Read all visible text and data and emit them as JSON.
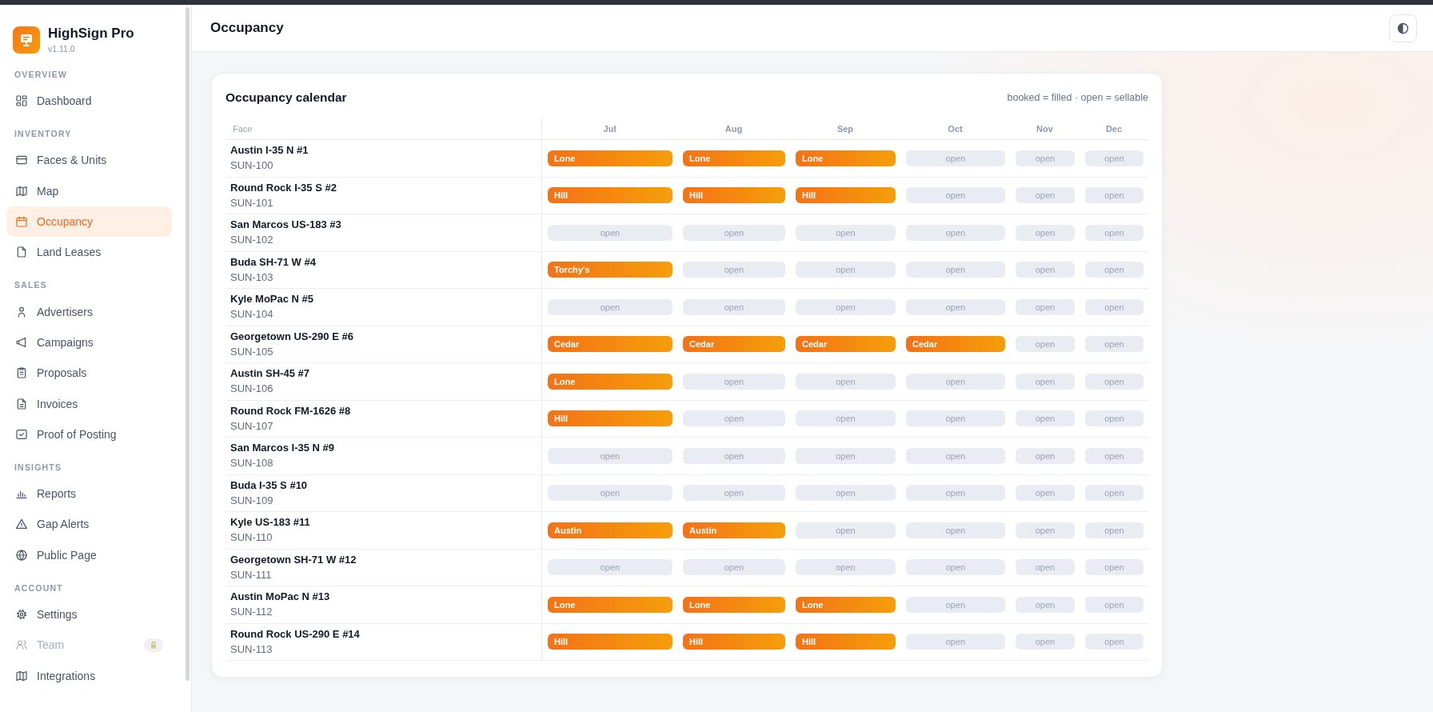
{
  "app": {
    "name": "HighSign Pro",
    "version": "v1.11.0"
  },
  "sidebar": {
    "sections": [
      {
        "title": "OVERVIEW",
        "items": [
          {
            "label": "Dashboard",
            "selected": false,
            "disabled": false
          }
        ]
      },
      {
        "title": "INVENTORY",
        "items": [
          {
            "label": "Faces & Units",
            "selected": false,
            "disabled": false
          },
          {
            "label": "Map",
            "selected": false,
            "disabled": false
          },
          {
            "label": "Occupancy",
            "selected": true,
            "disabled": false
          },
          {
            "label": "Land Leases",
            "selected": false,
            "disabled": false
          }
        ]
      },
      {
        "title": "SALES",
        "items": [
          {
            "label": "Advertisers",
            "selected": false,
            "disabled": false
          },
          {
            "label": "Campaigns",
            "selected": false,
            "disabled": false
          },
          {
            "label": "Proposals",
            "selected": false,
            "disabled": false
          },
          {
            "label": "Invoices",
            "selected": false,
            "disabled": false
          },
          {
            "label": "Proof of Posting",
            "selected": false,
            "disabled": false
          }
        ]
      },
      {
        "title": "INSIGHTS",
        "items": [
          {
            "label": "Reports",
            "selected": false,
            "disabled": false
          },
          {
            "label": "Gap Alerts",
            "selected": false,
            "disabled": false
          },
          {
            "label": "Public Page",
            "selected": false,
            "disabled": false
          }
        ]
      },
      {
        "title": "ACCOUNT",
        "items": [
          {
            "label": "Settings",
            "selected": false,
            "disabled": false
          },
          {
            "label": "Team",
            "selected": false,
            "disabled": true
          },
          {
            "label": "Integrations",
            "selected": false,
            "disabled": false
          }
        ]
      }
    ]
  },
  "header": {
    "title": "Occupancy"
  },
  "calendar": {
    "title": "Occupancy calendar",
    "legend": "booked = filled · open = sellable",
    "columns": [
      "Face",
      "Jul",
      "Aug",
      "Sep",
      "Oct",
      "Nov",
      "Dec"
    ],
    "rows": [
      {
        "name": "Austin I-35 N #1",
        "code": "SUN-100",
        "slots": [
          {
            "kind": "booked",
            "text": "Lone"
          },
          {
            "kind": "booked",
            "text": "Lone"
          },
          {
            "kind": "booked",
            "text": "Lone"
          },
          {
            "kind": "open",
            "text": "open"
          },
          {
            "kind": "open",
            "text": "open"
          },
          {
            "kind": "open",
            "text": "open"
          }
        ]
      },
      {
        "name": "Round Rock I-35 S #2",
        "code": "SUN-101",
        "slots": [
          {
            "kind": "booked",
            "text": "Hill"
          },
          {
            "kind": "booked",
            "text": "Hill"
          },
          {
            "kind": "booked",
            "text": "Hill"
          },
          {
            "kind": "open",
            "text": "open"
          },
          {
            "kind": "open",
            "text": "open"
          },
          {
            "kind": "open",
            "text": "open"
          }
        ]
      },
      {
        "name": "San Marcos US-183 #3",
        "code": "SUN-102",
        "slots": [
          {
            "kind": "open",
            "text": "open"
          },
          {
            "kind": "open",
            "text": "open"
          },
          {
            "kind": "open",
            "text": "open"
          },
          {
            "kind": "open",
            "text": "open"
          },
          {
            "kind": "open",
            "text": "open"
          },
          {
            "kind": "open",
            "text": "open"
          }
        ]
      },
      {
        "name": "Buda SH-71 W #4",
        "code": "SUN-103",
        "slots": [
          {
            "kind": "booked",
            "text": "Torchy's"
          },
          {
            "kind": "open",
            "text": "open"
          },
          {
            "kind": "open",
            "text": "open"
          },
          {
            "kind": "open",
            "text": "open"
          },
          {
            "kind": "open",
            "text": "open"
          },
          {
            "kind": "open",
            "text": "open"
          }
        ]
      },
      {
        "name": "Kyle MoPac N #5",
        "code": "SUN-104",
        "slots": [
          {
            "kind": "open",
            "text": "open"
          },
          {
            "kind": "open",
            "text": "open"
          },
          {
            "kind": "open",
            "text": "open"
          },
          {
            "kind": "open",
            "text": "open"
          },
          {
            "kind": "open",
            "text": "open"
          },
          {
            "kind": "open",
            "text": "open"
          }
        ]
      },
      {
        "name": "Georgetown US-290 E #6",
        "code": "SUN-105",
        "slots": [
          {
            "kind": "booked",
            "text": "Cedar"
          },
          {
            "kind": "booked",
            "text": "Cedar"
          },
          {
            "kind": "booked",
            "text": "Cedar"
          },
          {
            "kind": "booked",
            "text": "Cedar"
          },
          {
            "kind": "open",
            "text": "open"
          },
          {
            "kind": "open",
            "text": "open"
          }
        ]
      },
      {
        "name": "Austin SH-45 #7",
        "code": "SUN-106",
        "slots": [
          {
            "kind": "booked",
            "text": "Lone"
          },
          {
            "kind": "open",
            "text": "open"
          },
          {
            "kind": "open",
            "text": "open"
          },
          {
            "kind": "open",
            "text": "open"
          },
          {
            "kind": "open",
            "text": "open"
          },
          {
            "kind": "open",
            "text": "open"
          }
        ]
      },
      {
        "name": "Round Rock FM-1626 #8",
        "code": "SUN-107",
        "slots": [
          {
            "kind": "booked",
            "text": "Hill"
          },
          {
            "kind": "open",
            "text": "open"
          },
          {
            "kind": "open",
            "text": "open"
          },
          {
            "kind": "open",
            "text": "open"
          },
          {
            "kind": "open",
            "text": "open"
          },
          {
            "kind": "open",
            "text": "open"
          }
        ]
      },
      {
        "name": "San Marcos I-35 N #9",
        "code": "SUN-108",
        "slots": [
          {
            "kind": "open",
            "text": "open"
          },
          {
            "kind": "open",
            "text": "open"
          },
          {
            "kind": "open",
            "text": "open"
          },
          {
            "kind": "open",
            "text": "open"
          },
          {
            "kind": "open",
            "text": "open"
          },
          {
            "kind": "open",
            "text": "open"
          }
        ]
      },
      {
        "name": "Buda I-35 S #10",
        "code": "SUN-109",
        "slots": [
          {
            "kind": "open",
            "text": "open"
          },
          {
            "kind": "open",
            "text": "open"
          },
          {
            "kind": "open",
            "text": "open"
          },
          {
            "kind": "open",
            "text": "open"
          },
          {
            "kind": "open",
            "text": "open"
          },
          {
            "kind": "open",
            "text": "open"
          }
        ]
      },
      {
        "name": "Kyle US-183 #11",
        "code": "SUN-110",
        "slots": [
          {
            "kind": "booked",
            "text": "Austin"
          },
          {
            "kind": "booked",
            "text": "Austin"
          },
          {
            "kind": "open",
            "text": "open"
          },
          {
            "kind": "open",
            "text": "open"
          },
          {
            "kind": "open",
            "text": "open"
          },
          {
            "kind": "open",
            "text": "open"
          }
        ]
      },
      {
        "name": "Georgetown SH-71 W #12",
        "code": "SUN-111",
        "slots": [
          {
            "kind": "open",
            "text": "open"
          },
          {
            "kind": "open",
            "text": "open"
          },
          {
            "kind": "open",
            "text": "open"
          },
          {
            "kind": "open",
            "text": "open"
          },
          {
            "kind": "open",
            "text": "open"
          },
          {
            "kind": "open",
            "text": "open"
          }
        ]
      },
      {
        "name": "Austin MoPac N #13",
        "code": "SUN-112",
        "slots": [
          {
            "kind": "booked",
            "text": "Lone"
          },
          {
            "kind": "booked",
            "text": "Lone"
          },
          {
            "kind": "booked",
            "text": "Lone"
          },
          {
            "kind": "open",
            "text": "open"
          },
          {
            "kind": "open",
            "text": "open"
          },
          {
            "kind": "open",
            "text": "open"
          }
        ]
      },
      {
        "name": "Round Rock US-290 E #14",
        "code": "SUN-113",
        "slots": [
          {
            "kind": "booked",
            "text": "Hill"
          },
          {
            "kind": "booked",
            "text": "Hill"
          },
          {
            "kind": "booked",
            "text": "Hill"
          },
          {
            "kind": "open",
            "text": "open"
          },
          {
            "kind": "open",
            "text": "open"
          },
          {
            "kind": "open",
            "text": "open"
          }
        ]
      }
    ]
  }
}
